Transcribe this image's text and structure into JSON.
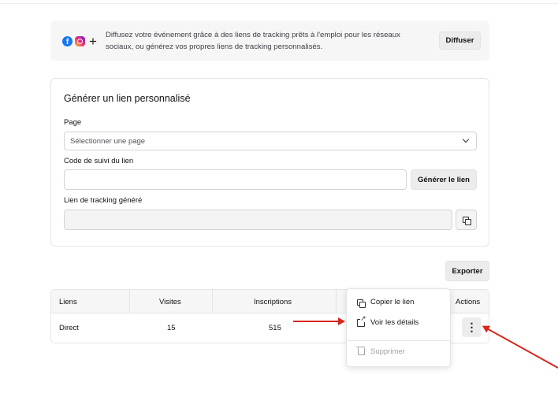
{
  "banner": {
    "text": "Diffusez votre événement grâce à des liens de tracking prêts à l'emploi pour les réseaux sociaux, ou générez vos propres liens de tracking personnalisés.",
    "button_label": "Diffuser",
    "icons": [
      "facebook-icon",
      "instagram-icon",
      "plus-icon"
    ]
  },
  "form": {
    "title": "Générer un lien personnalisé",
    "page_label": "Page",
    "page_placeholder": "Sélectionner une page",
    "code_label": "Code de suivi du lien",
    "code_value": "",
    "generate_label": "Générer le lien",
    "generated_label": "Lien de tracking généré",
    "generated_value": ""
  },
  "export_label": "Exporter",
  "table": {
    "columns": [
      "Liens",
      "Visites",
      "Inscriptions",
      "Actions"
    ],
    "rows": [
      {
        "lien": "Direct",
        "visites": "15",
        "inscriptions": "515"
      }
    ]
  },
  "menu": {
    "items": [
      {
        "label": "Copier le lien",
        "icon": "copy-icon",
        "disabled": false
      },
      {
        "label": "Voir les détails",
        "icon": "external-link-icon",
        "disabled": false
      },
      {
        "label": "Supprimer",
        "icon": "trash-icon",
        "disabled": true
      }
    ]
  },
  "colors": {
    "annotation_arrow": "#d9261c",
    "accent_button": "#ececed"
  }
}
